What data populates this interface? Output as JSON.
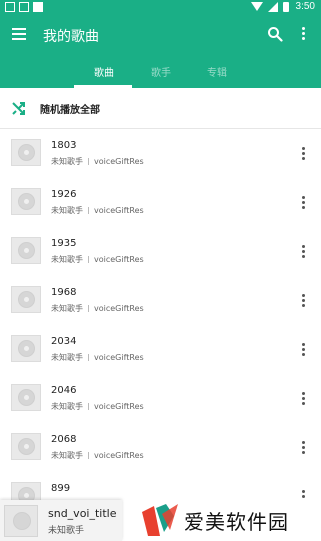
{
  "status_bar": {
    "time": "3:50"
  },
  "toolbar": {
    "title": "我的歌曲",
    "menu_icon": "hamburger-menu-icon",
    "search_icon": "search-icon",
    "more_icon": "more-vertical-icon"
  },
  "tabs": [
    {
      "label": "歌曲",
      "active": true
    },
    {
      "label": "歌手",
      "active": false
    },
    {
      "label": "专辑",
      "active": false
    }
  ],
  "shuffle": {
    "label": "随机播放全部",
    "icon": "shuffle-icon"
  },
  "songs": [
    {
      "title": "1803",
      "artist": "未知歌手",
      "album": "voiceGiftRes"
    },
    {
      "title": "1926",
      "artist": "未知歌手",
      "album": "voiceGiftRes"
    },
    {
      "title": "1935",
      "artist": "未知歌手",
      "album": "voiceGiftRes"
    },
    {
      "title": "1968",
      "artist": "未知歌手",
      "album": "voiceGiftRes"
    },
    {
      "title": "2034",
      "artist": "未知歌手",
      "album": "voiceGiftRes"
    },
    {
      "title": "2046",
      "artist": "未知歌手",
      "album": "voiceGiftRes"
    },
    {
      "title": "2068",
      "artist": "未知歌手",
      "album": "voiceGiftRes"
    },
    {
      "title": "899",
      "artist": "",
      "album": ""
    }
  ],
  "now_playing": {
    "title": "snd_voi_title",
    "artist": "未知歌手"
  },
  "watermark": {
    "text": "爱美软件园"
  },
  "colors": {
    "accent": "#1aaf86",
    "logo_red": "#e8402f",
    "logo_teal": "#1a9f8a"
  }
}
